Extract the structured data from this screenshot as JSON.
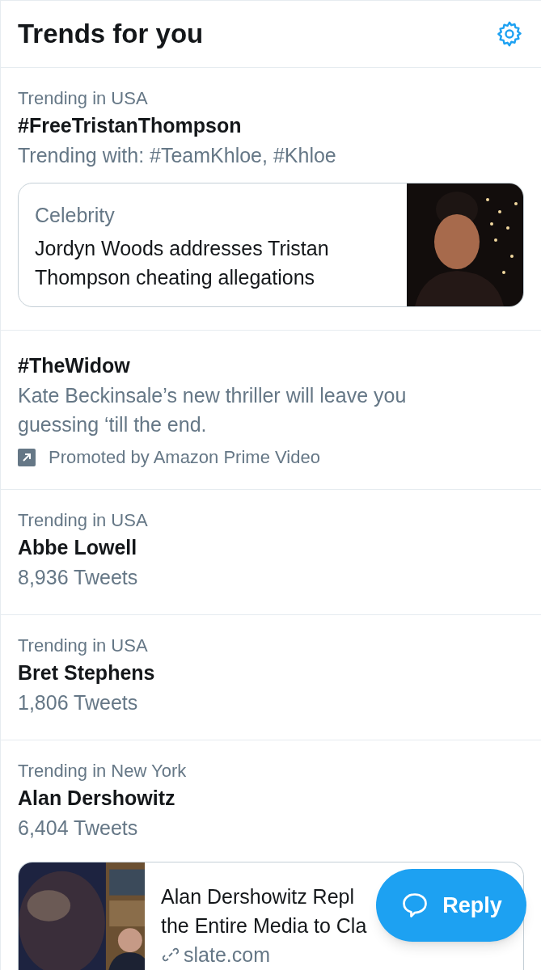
{
  "header": {
    "title": "Trends for you"
  },
  "trends": [
    {
      "kind": "trend",
      "context": "Trending in USA",
      "name": "#FreeTristanThompson",
      "detail": "Trending with: #TeamKhloe, #Khloe",
      "card": {
        "kind": "media_right",
        "category": "Celebrity",
        "headline": "Jordyn Woods addresses Tristan Thompson cheating allegations"
      }
    },
    {
      "kind": "promoted",
      "name": "#TheWidow",
      "detail": "Kate Beckinsale’s new thriller will leave you guessing ‘till the end.",
      "promoter": "Promoted by Amazon Prime Video"
    },
    {
      "kind": "trend",
      "context": "Trending in USA",
      "name": "Abbe Lowell",
      "detail": "8,936 Tweets"
    },
    {
      "kind": "trend",
      "context": "Trending in USA",
      "name": "Bret Stephens",
      "detail": "1,806 Tweets"
    },
    {
      "kind": "trend",
      "context": "Trending in New York",
      "name": "Alan Dershowitz",
      "detail": "6,404 Tweets",
      "card": {
        "kind": "media_left",
        "headline_lines": [
          "Alan Dershowitz Repl",
          "the Entire Media to Cla"
        ],
        "link": "slate.com"
      }
    }
  ],
  "reply_button": {
    "label": "Reply"
  }
}
